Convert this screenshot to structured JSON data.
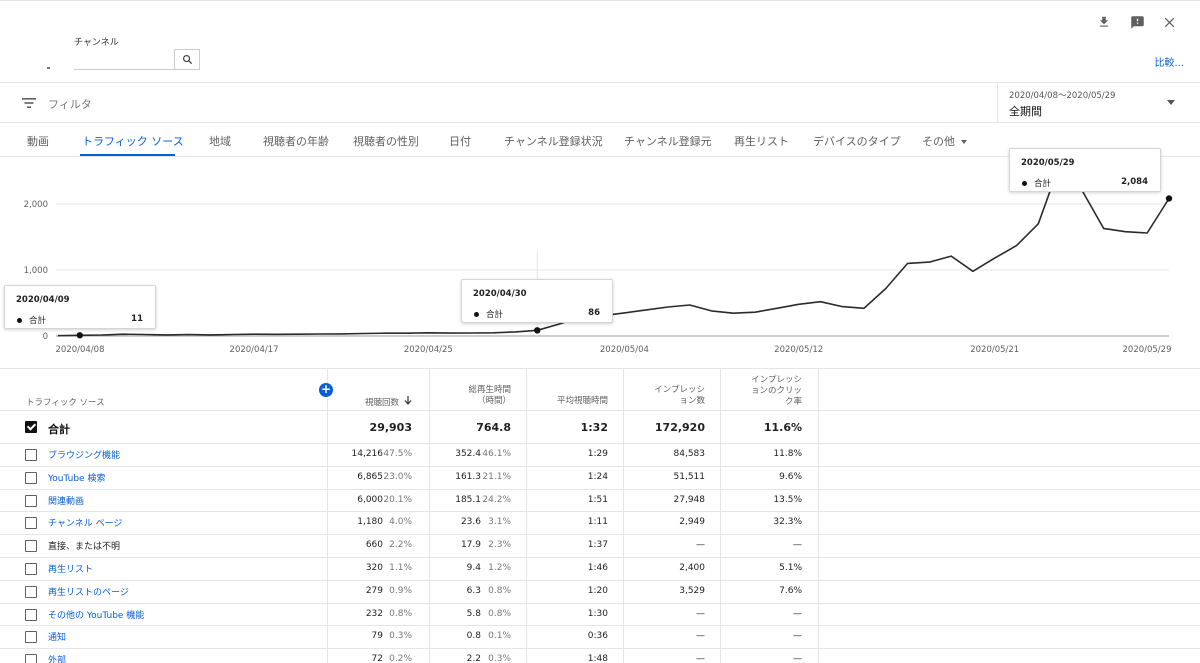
{
  "header": {
    "channel_label": "チャンネル",
    "search_value": "",
    "compare_label": "比較...",
    "icons": [
      "download-icon",
      "feedback-icon",
      "close-icon"
    ]
  },
  "filter": {
    "placeholder": "フィルタ",
    "date_range": "2020/04/08〜2020/05/29",
    "period": "全期間"
  },
  "tabs": [
    {
      "label": "動画"
    },
    {
      "label": "トラフィック ソース",
      "active": true
    },
    {
      "label": "地域"
    },
    {
      "label": "視聴者の年齢"
    },
    {
      "label": "視聴者の性別"
    },
    {
      "label": "日付"
    },
    {
      "label": "チャンネル登録状況"
    },
    {
      "label": "チャンネル登録元"
    },
    {
      "label": "再生リスト"
    },
    {
      "label": "デバイスのタイプ"
    },
    {
      "label": "その他"
    }
  ],
  "chart_data": {
    "type": "line",
    "series": [
      {
        "name": "合計"
      }
    ],
    "x": [
      "2020/04/08",
      "2020/04/09",
      "2020/04/10",
      "2020/04/11",
      "2020/04/12",
      "2020/04/13",
      "2020/04/14",
      "2020/04/15",
      "2020/04/16",
      "2020/04/17",
      "2020/04/18",
      "2020/04/19",
      "2020/04/20",
      "2020/04/21",
      "2020/04/22",
      "2020/04/23",
      "2020/04/24",
      "2020/04/25",
      "2020/04/26",
      "2020/04/27",
      "2020/04/28",
      "2020/04/29",
      "2020/04/30",
      "2020/05/01",
      "2020/05/02",
      "2020/05/03",
      "2020/05/04",
      "2020/05/05",
      "2020/05/06",
      "2020/05/07",
      "2020/05/08",
      "2020/05/09",
      "2020/05/10",
      "2020/05/11",
      "2020/05/12",
      "2020/05/13",
      "2020/05/14",
      "2020/05/15",
      "2020/05/16",
      "2020/05/17",
      "2020/05/18",
      "2020/05/19",
      "2020/05/20",
      "2020/05/21",
      "2020/05/22",
      "2020/05/23",
      "2020/05/24",
      "2020/05/25",
      "2020/05/26",
      "2020/05/27",
      "2020/05/28",
      "2020/05/29"
    ],
    "values": [
      5,
      11,
      15,
      28,
      22,
      17,
      22,
      17,
      22,
      28,
      26,
      28,
      30,
      32,
      38,
      43,
      42,
      48,
      44,
      46,
      48,
      62,
      86,
      180,
      290,
      308,
      350,
      395,
      440,
      470,
      380,
      345,
      360,
      420,
      480,
      520,
      445,
      420,
      720,
      1100,
      1120,
      1210,
      980,
      1180,
      1370,
      1700,
      2620,
      2210,
      1630,
      1580,
      1560,
      2084
    ],
    "x_tick_labels": [
      "2020/04/08",
      "2020/04/17",
      "2020/04/25",
      "2020/05/04",
      "2020/05/12",
      "2020/05/21",
      "2020/05/29"
    ],
    "y_ticks": [
      0,
      1000,
      2000
    ],
    "y_tick_labels": [
      "0",
      "1,000",
      "2,000"
    ],
    "ylim": [
      0,
      2500
    ],
    "grid": true,
    "tooltips": [
      {
        "date": "2020/04/09",
        "label": "合計",
        "value": "11"
      },
      {
        "date": "2020/04/30",
        "label": "合計",
        "value": "86"
      },
      {
        "date": "2020/05/29",
        "label": "合計",
        "value": "2,084"
      }
    ]
  },
  "table": {
    "headers": {
      "source": "トラフィック ソース",
      "views": "視聴回数",
      "watch_time_1": "総再生時間",
      "watch_time_2": "（時間）",
      "avg": "平均視聴時間",
      "impr_1": "インプレッシ",
      "impr_2": "ョン数",
      "ctr_1": "インプレッシ",
      "ctr_2": "ョンのクリッ",
      "ctr_3": "ク率"
    },
    "total": {
      "source": "合計",
      "views": "29,903",
      "watch": "764.8",
      "avg": "1:32",
      "impressions": "172,920",
      "ctr": "11.6%"
    },
    "rows": [
      {
        "source": "ブラウジング機能",
        "link": true,
        "views": "14,216",
        "views_pct": "47.5%",
        "watch": "352.4",
        "watch_pct": "46.1%",
        "avg": "1:29",
        "impressions": "84,583",
        "ctr": "11.8%"
      },
      {
        "source": "YouTube 検索",
        "link": true,
        "views": "6,865",
        "views_pct": "23.0%",
        "watch": "161.3",
        "watch_pct": "21.1%",
        "avg": "1:24",
        "impressions": "51,511",
        "ctr": "9.6%"
      },
      {
        "source": "関連動画",
        "link": true,
        "views": "6,000",
        "views_pct": "20.1%",
        "watch": "185.1",
        "watch_pct": "24.2%",
        "avg": "1:51",
        "impressions": "27,948",
        "ctr": "13.5%"
      },
      {
        "source": "チャンネル ページ",
        "link": true,
        "views": "1,180",
        "views_pct": "4.0%",
        "watch": "23.6",
        "watch_pct": "3.1%",
        "avg": "1:11",
        "impressions": "2,949",
        "ctr": "32.3%"
      },
      {
        "source": "直接、または不明",
        "link": false,
        "views": "660",
        "views_pct": "2.2%",
        "watch": "17.9",
        "watch_pct": "2.3%",
        "avg": "1:37",
        "impressions": "—",
        "ctr": "—"
      },
      {
        "source": "再生リスト",
        "link": true,
        "views": "320",
        "views_pct": "1.1%",
        "watch": "9.4",
        "watch_pct": "1.2%",
        "avg": "1:46",
        "impressions": "2,400",
        "ctr": "5.1%"
      },
      {
        "source": "再生リストのページ",
        "link": true,
        "views": "279",
        "views_pct": "0.9%",
        "watch": "6.3",
        "watch_pct": "0.8%",
        "avg": "1:20",
        "impressions": "3,529",
        "ctr": "7.6%"
      },
      {
        "source": "その他の YouTube 機能",
        "link": true,
        "views": "232",
        "views_pct": "0.8%",
        "watch": "5.8",
        "watch_pct": "0.8%",
        "avg": "1:30",
        "impressions": "—",
        "ctr": "—"
      },
      {
        "source": "通知",
        "link": true,
        "views": "79",
        "views_pct": "0.3%",
        "watch": "0.8",
        "watch_pct": "0.1%",
        "avg": "0:36",
        "impressions": "—",
        "ctr": "—"
      },
      {
        "source": "外部",
        "link": true,
        "views": "72",
        "views_pct": "0.2%",
        "watch": "2.2",
        "watch_pct": "0.3%",
        "avg": "1:48",
        "impressions": "—",
        "ctr": "—"
      }
    ]
  }
}
